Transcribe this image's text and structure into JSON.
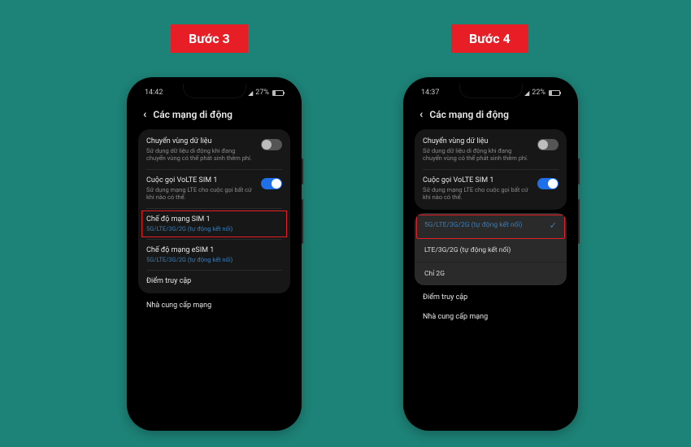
{
  "steps": {
    "s3": "Bước 3",
    "s4": "Bước 4"
  },
  "screen": {
    "title": "Các mạng di động",
    "roaming": {
      "title": "Chuyển vùng dữ liệu",
      "desc": "Sử dụng dữ liệu di động khi đang chuyển vùng có thể phát sinh thêm phí."
    },
    "volte": {
      "title": "Cuộc gọi VoLTE SIM 1",
      "desc": "Sử dụng mạng LTE cho cuộc gọi bất cứ khi nào có thể."
    },
    "netmode_sim1": {
      "title": "Chế độ mạng SIM 1",
      "sub": "5G/LTE/3G/2G (tự động kết nối)"
    },
    "netmode_esim": {
      "title": "Chế độ mạng eSIM 1",
      "sub": "5G/LTE/3G/2G (tự động kết nối)"
    },
    "apn": "Điểm truy cập",
    "operators": "Nhà cung cấp mạng"
  },
  "popup": {
    "opt1": "5G/LTE/3G/2G (tự động kết nối)",
    "opt2": "LTE/3G/2G (tự động kết nối)",
    "opt3": "Chỉ 2G"
  },
  "status": {
    "time_a": "14:42",
    "time_b": "14:37",
    "batt_a": "27%",
    "batt_b": "22%"
  }
}
